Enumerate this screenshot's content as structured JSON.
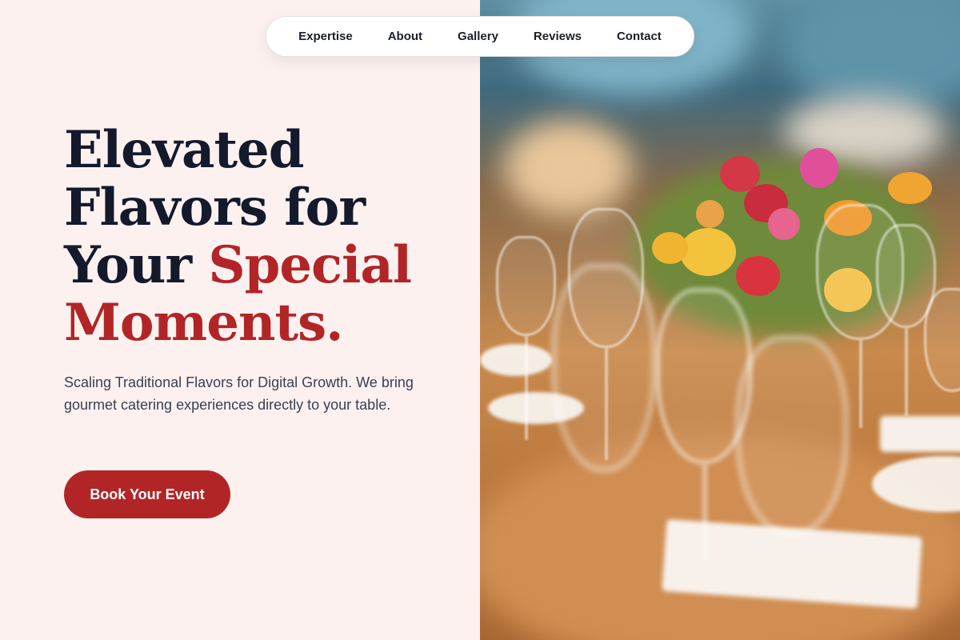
{
  "nav": {
    "items": [
      {
        "label": "Expertise"
      },
      {
        "label": "About"
      },
      {
        "label": "Gallery"
      },
      {
        "label": "Reviews"
      },
      {
        "label": "Contact"
      }
    ]
  },
  "hero": {
    "headline_line1": "Elevated",
    "headline_line2": "Flavors for",
    "headline_line3_plain": "Your ",
    "headline_line3_accent": "Special",
    "headline_line4_accent": "Moments.",
    "subtext": "Scaling Traditional Flavors for Digital Growth. We bring gourmet catering experiences directly to your table.",
    "cta_label": "Book Your Event"
  },
  "colors": {
    "accent": "#b22527",
    "heading": "#141a2c",
    "background": "#fdf1f0"
  }
}
